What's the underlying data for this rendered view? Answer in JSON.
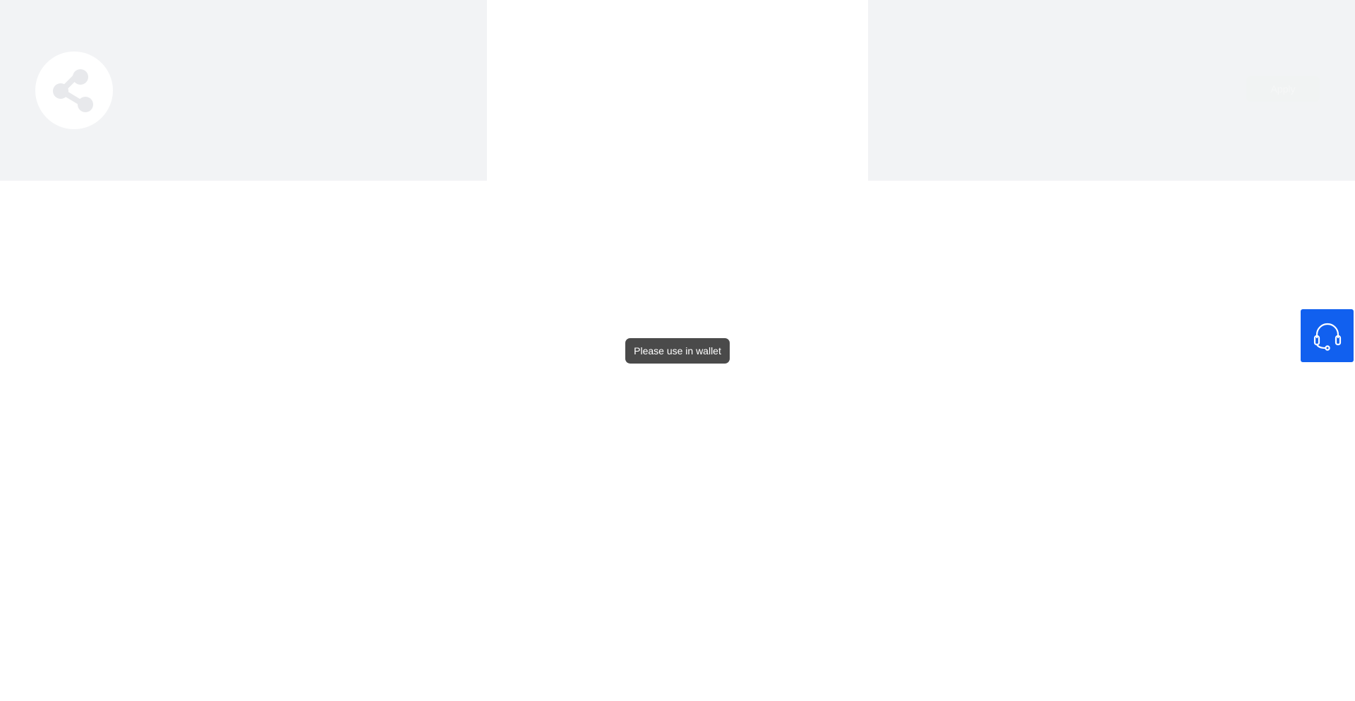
{
  "header": {
    "share_icon": "share-icon",
    "button_label": "Apply"
  },
  "toast": {
    "message": "Please use in wallet"
  },
  "support": {
    "icon": "headset-icon"
  },
  "colors": {
    "panel_bg": "#f2f3f5",
    "toast_bg": "#4a4a4a",
    "support_bg": "#1160ef",
    "white": "#ffffff"
  }
}
